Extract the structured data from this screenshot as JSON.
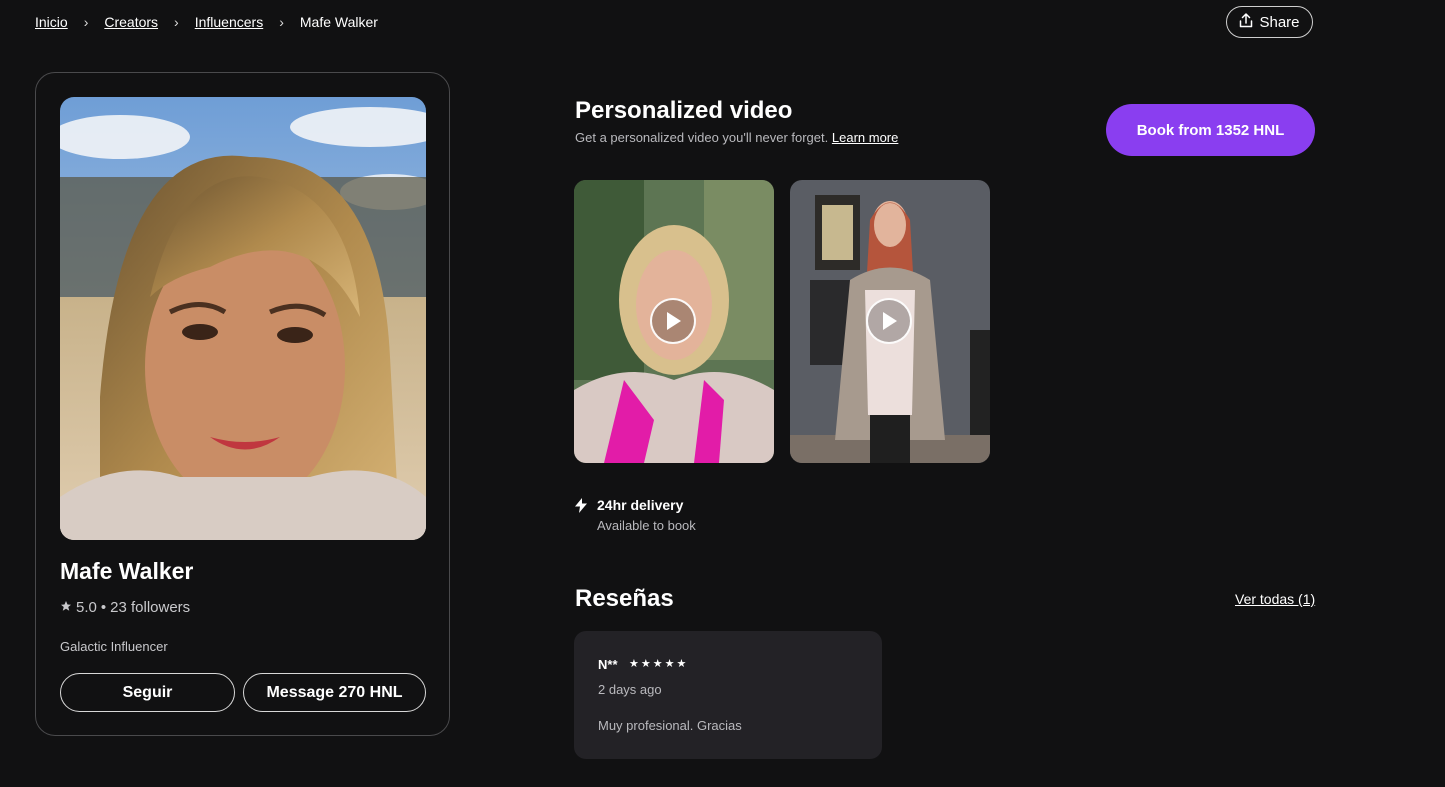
{
  "breadcrumb": {
    "items": [
      "Inicio",
      "Creators",
      "Influencers"
    ],
    "current": "Mafe Walker",
    "separator": "›"
  },
  "share": {
    "label": "Share",
    "icon": "share-icon"
  },
  "profile": {
    "name": "Mafe Walker",
    "rating": "5.0",
    "followers": "23 followers",
    "meta_separator": "•",
    "role": "Galactic Influencer",
    "follow_label": "Seguir",
    "message_label": "Message 270 HNL"
  },
  "video_section": {
    "title": "Personalized video",
    "subtitle": "Get a personalized video you'll never forget.",
    "learn_more": "Learn more",
    "book_label": "Book from 1352 HNL",
    "delivery_title": "24hr delivery",
    "delivery_sub": "Available to book"
  },
  "reviews": {
    "title": "Reseñas",
    "see_all": "Ver todas (1)",
    "items": [
      {
        "name": "N**",
        "stars": "★★★★★",
        "date": "2 days ago",
        "text": "Muy profesional. Gracias"
      }
    ]
  },
  "colors": {
    "background": "#111112",
    "accent": "#8a3ef0",
    "card": "#232226"
  }
}
